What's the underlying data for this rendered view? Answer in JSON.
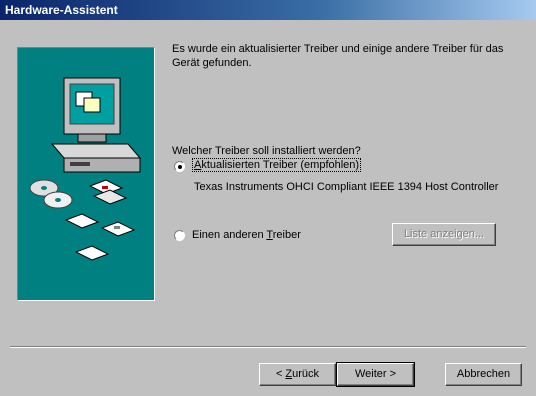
{
  "window": {
    "title": "Hardware-Assistent"
  },
  "content": {
    "intro": "Es wurde ein aktualisierter Treiber und einige andere Treiber für das Gerät gefunden.",
    "question": "Welcher Treiber soll installiert werden?",
    "option_updated": {
      "label_before": "",
      "accel": "A",
      "label_after": "ktualisierten Treiber (empfohlen)",
      "selected": true
    },
    "driver_name": "Texas Instruments OHCI Compliant IEEE 1394 Host Controller",
    "option_other": {
      "label_before": "Einen anderen ",
      "accel": "T",
      "label_after": "reiber",
      "selected": false
    },
    "list_button": "Liste anzeigen..."
  },
  "footer": {
    "back_before": "< ",
    "back_accel": "Z",
    "back_after": "urück",
    "next": "Weiter >",
    "cancel": "Abbrechen"
  },
  "colors": {
    "title_gradient_start": "#0a246a",
    "title_gradient_end": "#a6caf0",
    "art_background": "#008080",
    "window_face": "#c0c0c0"
  }
}
